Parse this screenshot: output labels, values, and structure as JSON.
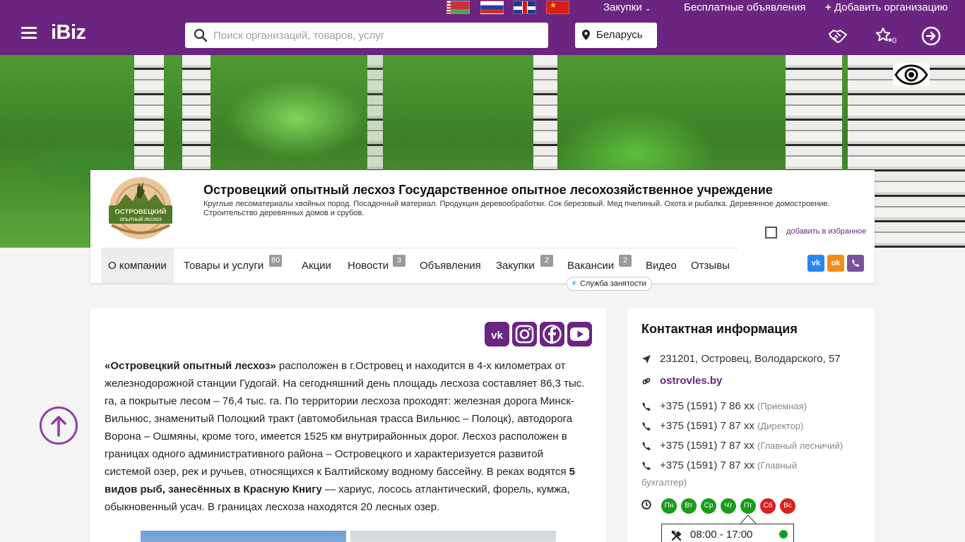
{
  "topbar": {
    "flags": [
      "Беларусь",
      "Русский",
      "English",
      "中文"
    ],
    "procurement_label": "Закупки",
    "free_ads_label": "Бесплатные объявления",
    "add_org_label": "Добавить организацию"
  },
  "header": {
    "logo": "iBiz",
    "search_placeholder": "Поиск организаций, товаров, услуг",
    "region": "Беларусь",
    "favorites_count": "0"
  },
  "company": {
    "logo_text_top": "ОСТРОВЕЦКИЙ",
    "logo_text_bottom": "ОПЫТНЫЙ ЛЕСХОЗ",
    "title": "Островецкий опытный лесхоз Государственное опытное лесохозяйственное учреждение",
    "description": "Круглые лесоматериалы хвойных пород. Посадочный материал. Продукция деревообработки. Сок березовый. Мед пчелиный. Охота и рыбалка. Деревянное домостроение. Строительство деревянных домов и срубов.",
    "favorite_label": "добавить в избранное"
  },
  "tabs": [
    {
      "label": "О компании"
    },
    {
      "label": "Товары и услуги",
      "badge": "80"
    },
    {
      "label": "Акции"
    },
    {
      "label": "Новости",
      "badge": "3"
    },
    {
      "label": "Объявления"
    },
    {
      "label": "Закупки",
      "badge": "2"
    },
    {
      "label": "Вакансии",
      "badge": "2"
    },
    {
      "label": "Видео"
    },
    {
      "label": "Отзывы"
    }
  ],
  "tooltip": "Служба занятости",
  "social_small": [
    "vk-icon",
    "ok-icon",
    "viber-icon"
  ],
  "social_big": [
    "vk-icon",
    "instagram-icon",
    "facebook-icon",
    "youtube-icon"
  ],
  "about": {
    "lead": "«Островецкий опытный лесхоз»",
    "p1": " расположен в г.Островец и находится в 4-х километрах от железнодорожной станции Гудогай. На сегодняшний день площадь лесхоза составляет 86,3 тыс. га, а покрытые лесом – 76,4 тыс. га. По территории лесхоза проходят: железная дорога Минск-Вильнюс, знаменитый Полоцкий тракт (автомобильная трасса Вильнюс – Полоцк), автодорога Ворона – Ошмяны, кроме того, имеется 1525 км внутрирайонных дорог. Лесхоз расположен в границах одного административного района – Островецкого и характеризуется развитой системой озер, рек и ручьев, относящихся к Балтийскому водному бассейну. В реках водятся ",
    "fish": "5 видов рыб, занесённых в",
    "red_book": "Красную Книгу",
    "p2": " — хариус, лосось атлантический, форель, кумжа, обыкновенный усач. В границах лесхоза находятся 20 лесных озер."
  },
  "contacts": {
    "title": "Контактная информация",
    "address": "231201, Островец, Володарского, 57",
    "website": "ostrovles.by",
    "phones": [
      {
        "number": "+375 (1591) 7 86 xx",
        "note": "(Приемная)"
      },
      {
        "number": "+375 (1591) 7 87 xx",
        "note": "(Директор)"
      },
      {
        "number": "+375 (1591) 7 87 xx",
        "note": "(Главный лесничий)"
      },
      {
        "number": "+375 (1591) 7 87 xx",
        "note": "(Главный"
      },
      {
        "number": "",
        "note": "бухгалтер)"
      }
    ],
    "days": [
      {
        "label": "Пн",
        "color": "#1a9c1a"
      },
      {
        "label": "Вт",
        "color": "#1a9c1a"
      },
      {
        "label": "Ср",
        "color": "#1a9c1a"
      },
      {
        "label": "Чт",
        "color": "#1a9c1a"
      },
      {
        "label": "Пт",
        "color": "#1a9c1a"
      },
      {
        "label": "Сб",
        "color": "#d9201c"
      },
      {
        "label": "Вс",
        "color": "#d9201c"
      }
    ],
    "hours": "08:00 - 17:00"
  },
  "colors": {
    "brand": "#6b2580",
    "open": "#1a9c1a",
    "closed": "#d9201c"
  }
}
